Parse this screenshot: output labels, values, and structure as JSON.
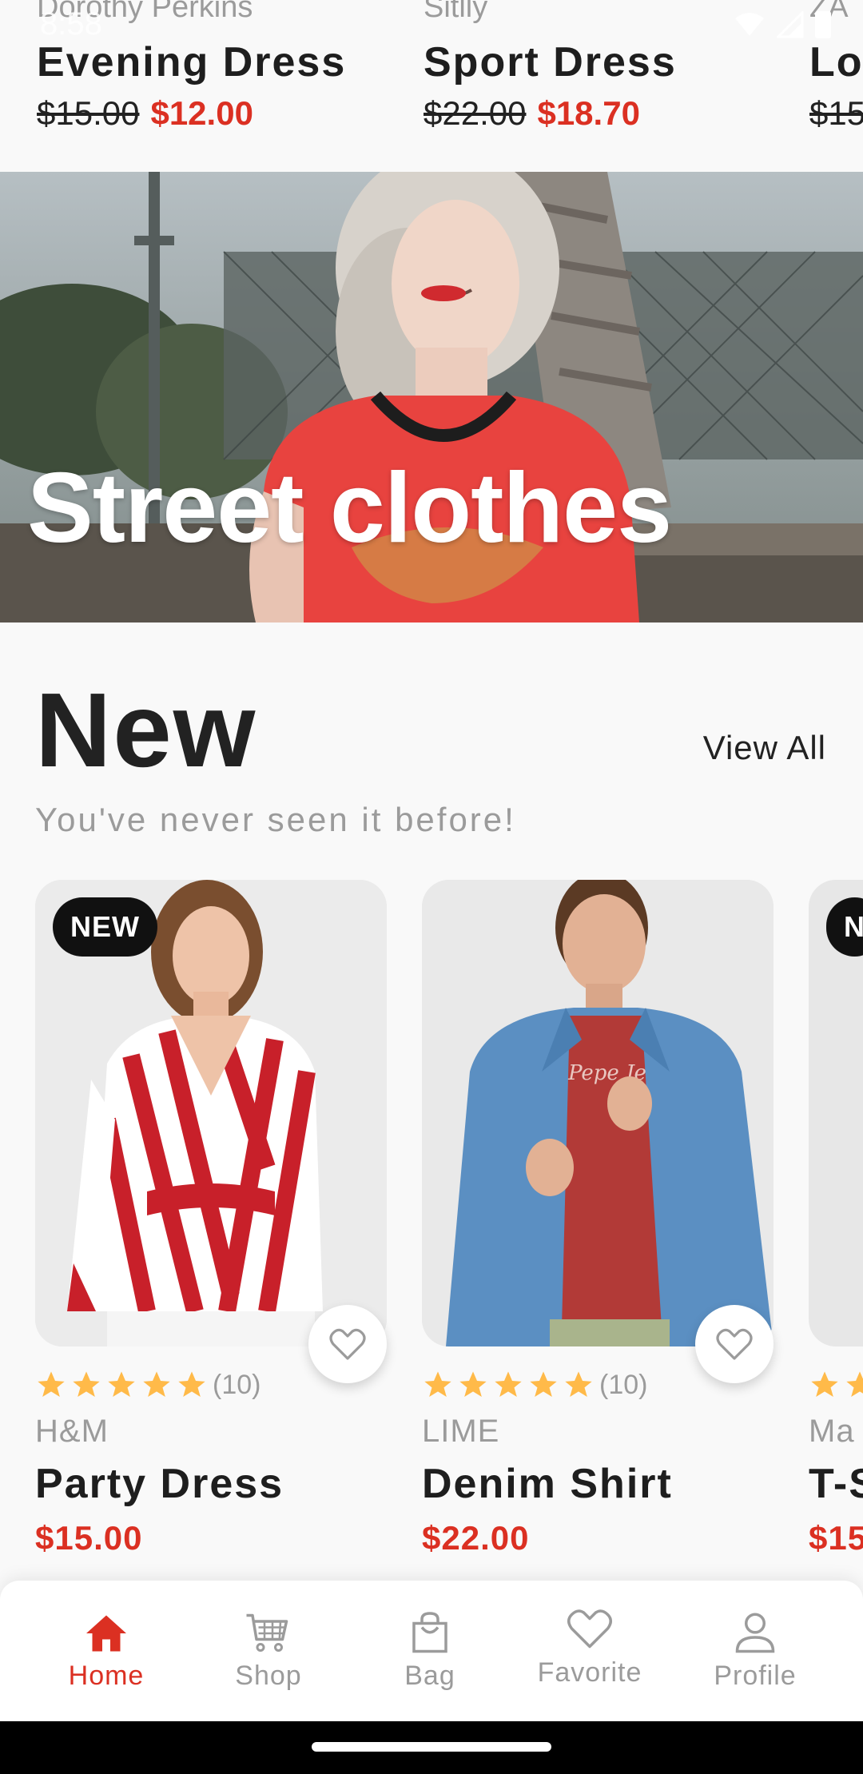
{
  "status_bar": {
    "time": "8:58"
  },
  "top_row": [
    {
      "brand": "Dorothy Perkins",
      "name": "Evening Dress",
      "old_price": "$15.00",
      "new_price": "$12.00"
    },
    {
      "brand": "Sitlly",
      "name": "Sport Dress",
      "old_price": "$22.00",
      "new_price": "$18.70"
    },
    {
      "brand": "ZA",
      "name": "Lo",
      "old_price": "$15",
      "new_price": ""
    }
  ],
  "banner": {
    "title": "Street clothes"
  },
  "new_section": {
    "title": "New",
    "view_all": "View All",
    "subtitle": "You've never seen it before!"
  },
  "products": [
    {
      "badge": "NEW",
      "rating_count": "(10)",
      "stars": 5,
      "brand": "H&M",
      "name": "Party Dress",
      "price": "$15.00"
    },
    {
      "badge": "",
      "rating_count": "(10)",
      "stars": 5,
      "brand": "LIME",
      "name": "Denim Shirt",
      "price": "$22.00"
    },
    {
      "badge": "N",
      "rating_count": "",
      "stars": 5,
      "brand": "Ma",
      "name": "T-S",
      "price": "$15"
    }
  ],
  "bottom_nav": {
    "items": [
      {
        "label": "Home",
        "icon": "home-icon",
        "active": true
      },
      {
        "label": "Shop",
        "icon": "cart-icon",
        "active": false
      },
      {
        "label": "Bag",
        "icon": "bag-icon",
        "active": false
      },
      {
        "label": "Favorite",
        "icon": "heart-icon",
        "active": false
      },
      {
        "label": "Profile",
        "icon": "profile-icon",
        "active": false
      }
    ]
  },
  "colors": {
    "accent": "#DB3022",
    "background": "#F9F9F9",
    "muted_text": "#9B9B9B",
    "star": "#FFBA49"
  }
}
